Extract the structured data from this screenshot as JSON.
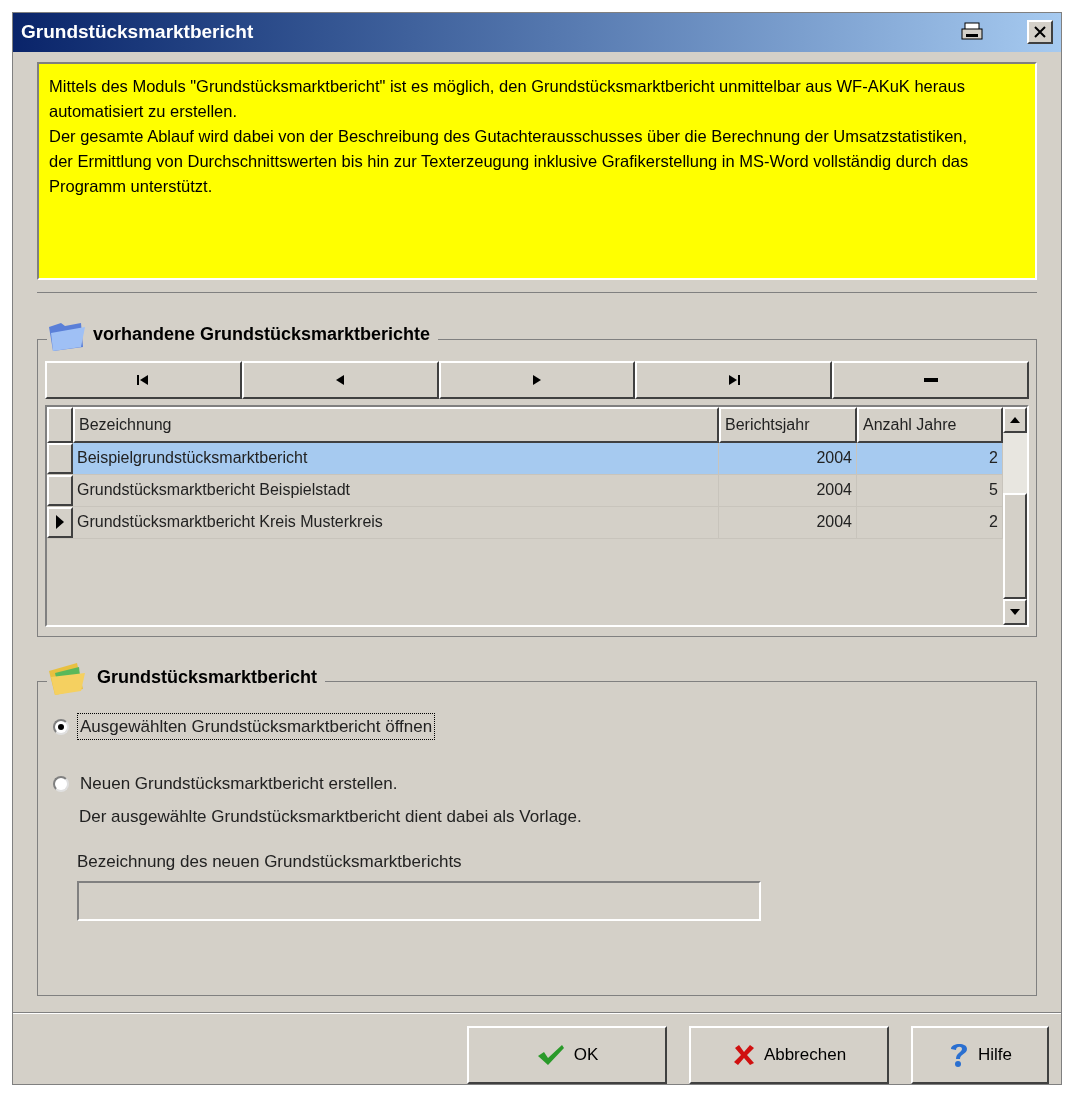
{
  "window": {
    "title": "Grundstücksmarktbericht"
  },
  "info_text": "Mittels des Moduls \"Grundstücksmarktbericht\" ist es möglich, den Grundstücksmarktbericht unmittelbar aus WF-AKuK heraus automatisiert zu erstellen.\nDer gesamte Ablauf wird dabei von der Beschreibung des Gutachterausschusses über die Berechnung der Umsatzstatistiken, der Ermittlung von Durchschnittswerten bis hin zur Texterzeugung inklusive Grafikerstellung in MS-Word vollständig durch das Programm unterstützt.",
  "reports_group": {
    "title": "vorhandene Grundstücksmarktberichte",
    "table": {
      "columns": [
        "Bezeichnung",
        "Berichtsjahr",
        "Anzahl Jahre"
      ],
      "rows": [
        {
          "cells": [
            "Beispielgrundstücksmarktbericht",
            "2004",
            "2"
          ],
          "selected": true,
          "current": false
        },
        {
          "cells": [
            "Grundstücksmarktbericht Beispielstadt",
            "2004",
            "5"
          ],
          "selected": false,
          "current": false
        },
        {
          "cells": [
            "Grundstücksmarktbericht Kreis Musterkreis",
            "2004",
            "2"
          ],
          "selected": false,
          "current": true
        }
      ]
    }
  },
  "report_group": {
    "title": "Grundstücksmarktbericht",
    "options": [
      {
        "label": "Ausgewählten Grundstücksmarktbericht öffnen",
        "selected": true
      },
      {
        "label": "Neuen Grundstücksmarktbericht erstellen.",
        "selected": false,
        "note": "Der ausgewählte Grundstücksmarktbericht dient dabei als Vorlage."
      }
    ],
    "name_field": {
      "label": "Bezeichnung des neuen Grundstücksmarktberichts",
      "disabled": true
    }
  },
  "buttons": [
    {
      "kind": "ok",
      "label": "OK"
    },
    {
      "kind": "cancel",
      "label": "Abbrechen"
    },
    {
      "kind": "help",
      "label": "Hilfe"
    }
  ]
}
